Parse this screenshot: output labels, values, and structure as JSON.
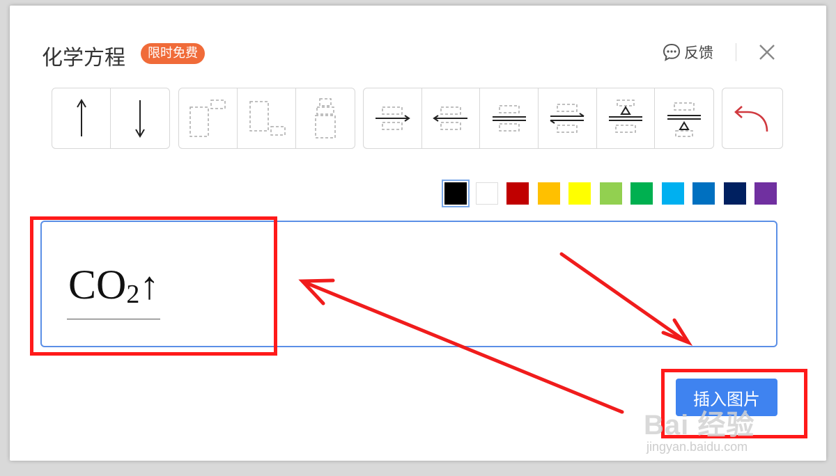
{
  "dialog": {
    "title": "化学方程",
    "badge": "限时免费",
    "feedback_label": "反馈"
  },
  "toolbar": {
    "groups": [
      [
        "arrow-up",
        "arrow-down"
      ],
      [
        "superscript",
        "subscript",
        "overscript"
      ],
      [
        "right-arrow-label",
        "left-arrow-label",
        "equals-label",
        "reversible-label",
        "heat-above",
        "heat-below"
      ],
      [
        "undo"
      ]
    ]
  },
  "colors": {
    "palette": [
      "#000000",
      "#ffffff",
      "#c00000",
      "#ffc000",
      "#ffff00",
      "#92d050",
      "#00b050",
      "#00b0f0",
      "#0070c0",
      "#002060",
      "#7030a0"
    ],
    "selected": "#000000",
    "annotation": "#ff1a1a",
    "accent": "#3f83f0"
  },
  "editor": {
    "formula_main": "CO",
    "formula_sub": "2",
    "formula_arrow": "↑"
  },
  "actions": {
    "insert_label": "插入图片"
  },
  "watermark": {
    "logo": "Bai 经验",
    "url": "jingyan.baidu.com"
  }
}
